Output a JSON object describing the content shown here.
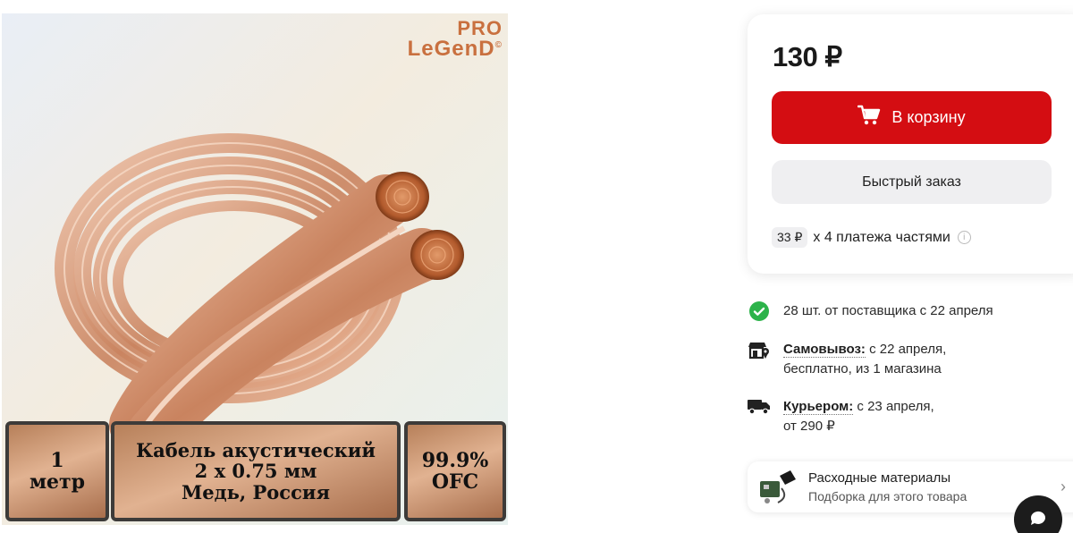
{
  "product_image": {
    "brand_line1": "PRO",
    "brand_line2": "LeGenD",
    "brand_mark": "©",
    "spec_left": [
      "1",
      "метр"
    ],
    "spec_mid": [
      "Кабель акустический",
      "2 x 0.75 мм",
      "Медь, Россия"
    ],
    "spec_right": [
      "99.9%",
      "OFC"
    ]
  },
  "price_card": {
    "price": "130 ₽",
    "cart_button_label": "В корзину",
    "quick_order_label": "Быстрый заказ",
    "installment_amount": "33 ₽",
    "installment_text": "х 4 платежа частями"
  },
  "availability": {
    "stock_text": "28 шт. от поставщика с 22 апреля",
    "pickup_link": "Самовывоз:",
    "pickup_text_line1": "с 22 апреля,",
    "pickup_text_line2": "бесплатно, из 1 магазина",
    "courier_link": "Курьером:",
    "courier_text_line1": "с 23 апреля,",
    "courier_text_line2": "от 290 ₽"
  },
  "consumables": {
    "title": "Расходные материалы",
    "subtitle": "Подборка для этого товара"
  },
  "colors": {
    "accent_red": "#d40d12",
    "success_green": "#2cb34a",
    "copper": "#c9703f"
  },
  "icons": [
    "cart-icon",
    "info-icon",
    "check-circle-icon",
    "store-pickup-icon",
    "truck-icon",
    "chevron-right-icon",
    "chat-icon"
  ]
}
